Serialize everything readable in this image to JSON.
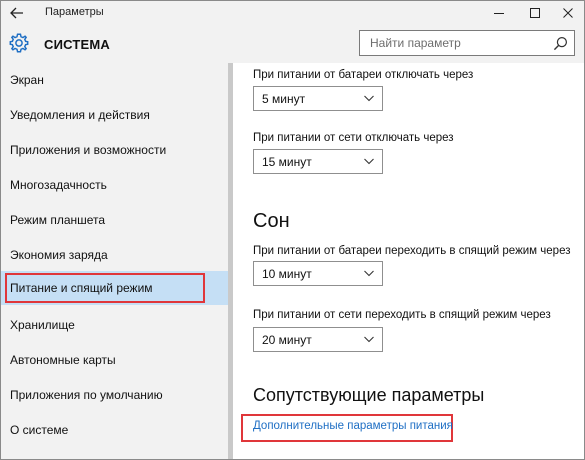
{
  "window": {
    "app_title": "Параметры",
    "back_icon": "arrow-left-icon",
    "controls": [
      "minimize-icon",
      "maximize-icon",
      "close-icon"
    ]
  },
  "header": {
    "section_icon": "gear-icon",
    "section_title": "СИСТЕМА",
    "search_placeholder": "Найти параметр",
    "search_icon": "search-icon"
  },
  "sidebar": {
    "items": [
      {
        "label": "Экран"
      },
      {
        "label": "Уведомления и действия"
      },
      {
        "label": "Приложения и возможности"
      },
      {
        "label": "Многозадачность"
      },
      {
        "label": "Режим планшета"
      },
      {
        "label": "Экономия заряда"
      },
      {
        "label": "Питание и спящий режим"
      },
      {
        "label": "Хранилище"
      },
      {
        "label": "Автономные карты"
      },
      {
        "label": "Приложения по умолчанию"
      },
      {
        "label": "О системе"
      }
    ],
    "selected_index": 6
  },
  "screen": {
    "battery_label": "При питании от батареи отключать через",
    "battery_value": "5 минут",
    "ac_label": "При питании от сети отключать через",
    "ac_value": "15 минут"
  },
  "sleep": {
    "heading": "Сон",
    "battery_label": "При питании от батареи переходить в спящий режим через",
    "battery_value": "10 минут",
    "ac_label": "При питании от сети переходить в спящий режим через",
    "ac_value": "20 минут"
  },
  "related": {
    "heading": "Сопутствующие параметры",
    "link": "Дополнительные параметры питания"
  },
  "colors": {
    "accent_link": "#1f6fc4",
    "selected_bg": "#c5dff5",
    "highlight_border": "#e0363a",
    "chrome_bg": "#f2f2f2"
  }
}
